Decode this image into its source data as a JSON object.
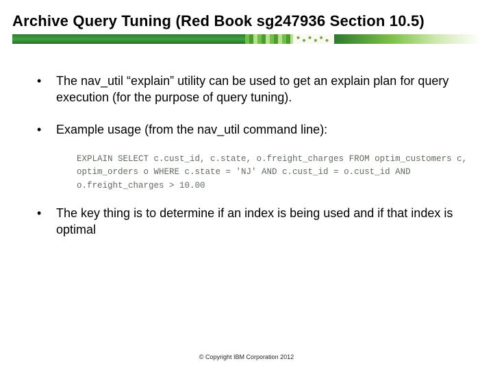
{
  "title": "Archive Query Tuning (Red Book sg247936 Section 10.5)",
  "bullets": {
    "b1": "The nav_util “explain” utility can be used to get an explain plan for query execution (for the purpose of query tuning).",
    "b2": "Example usage (from the nav_util command line):",
    "b3": "The key thing is to determine if an index is being used and if that index is optimal"
  },
  "code": {
    "line1": "EXPLAIN SELECT c.cust_id, c.state, o.freight_charges FROM optim_customers c,",
    "line2": "optim_orders o WHERE c.state = 'NJ' AND c.cust_id = o.cust_id AND",
    "line3": "o.freight_charges > 10.00"
  },
  "footer": "© Copyright IBM Corporation 2012"
}
